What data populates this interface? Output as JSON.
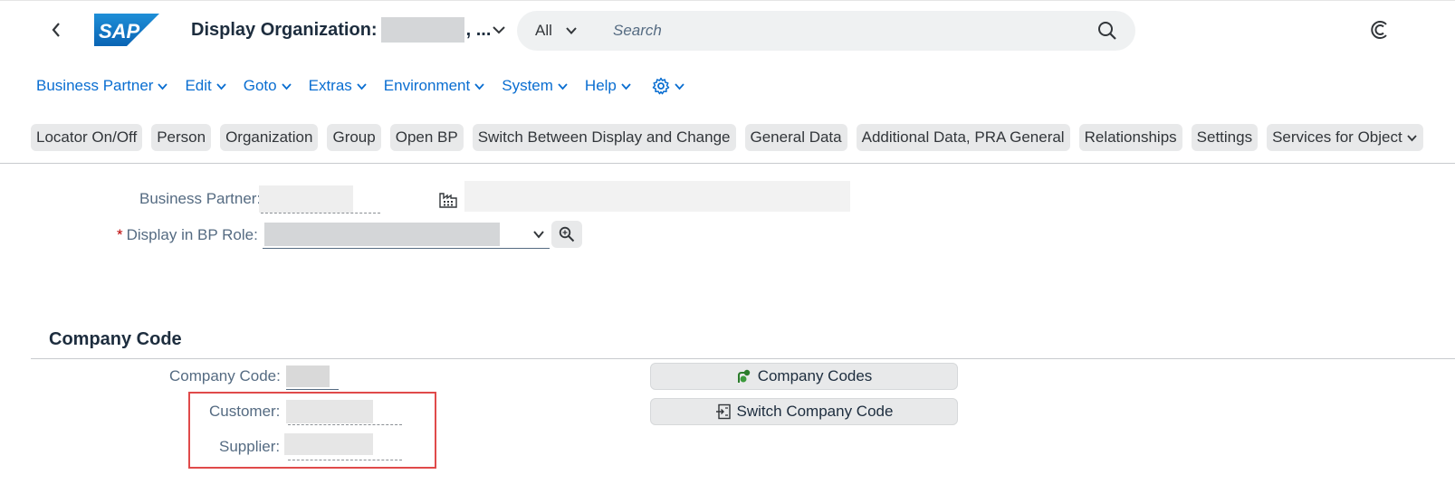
{
  "shell": {
    "back_icon": "chevron-left-icon",
    "logo_text": "SAP",
    "title_prefix": "Display Organization:",
    "title_suffix": ", ...",
    "search_scope": "All",
    "search_placeholder": "Search",
    "colors": {
      "brand_blue": "#0a6ed1",
      "logo_blue": "#0f7ac8",
      "background": "#ffffff"
    }
  },
  "menubar": {
    "items": [
      {
        "label": "Business Partner"
      },
      {
        "label": "Edit"
      },
      {
        "label": "Goto"
      },
      {
        "label": "Extras"
      },
      {
        "label": "Environment"
      },
      {
        "label": "System"
      },
      {
        "label": "Help"
      }
    ],
    "settings_icon": "gear-icon"
  },
  "toolbar": {
    "buttons": [
      {
        "label": "Locator On/Off"
      },
      {
        "label": "Person"
      },
      {
        "label": "Organization"
      },
      {
        "label": "Group"
      },
      {
        "label": "Open BP"
      },
      {
        "label": "Switch Between Display and Change"
      },
      {
        "label": "General Data"
      },
      {
        "label": "Additional Data, PRA General"
      },
      {
        "label": "Relationships"
      },
      {
        "label": "Settings"
      },
      {
        "label": "Services for Object"
      }
    ]
  },
  "header_form": {
    "business_partner_label": "Business Partner:",
    "required_marker": "*",
    "bp_role_label": "Display in BP Role:"
  },
  "company_code_section": {
    "title": "Company Code",
    "company_code_label": "Company Code:",
    "customer_label": "Customer:",
    "supplier_label": "Supplier:",
    "company_codes_button": "Company Codes",
    "switch_company_code_button": "Switch Company Code",
    "highlight_color": "#e04a4a"
  }
}
